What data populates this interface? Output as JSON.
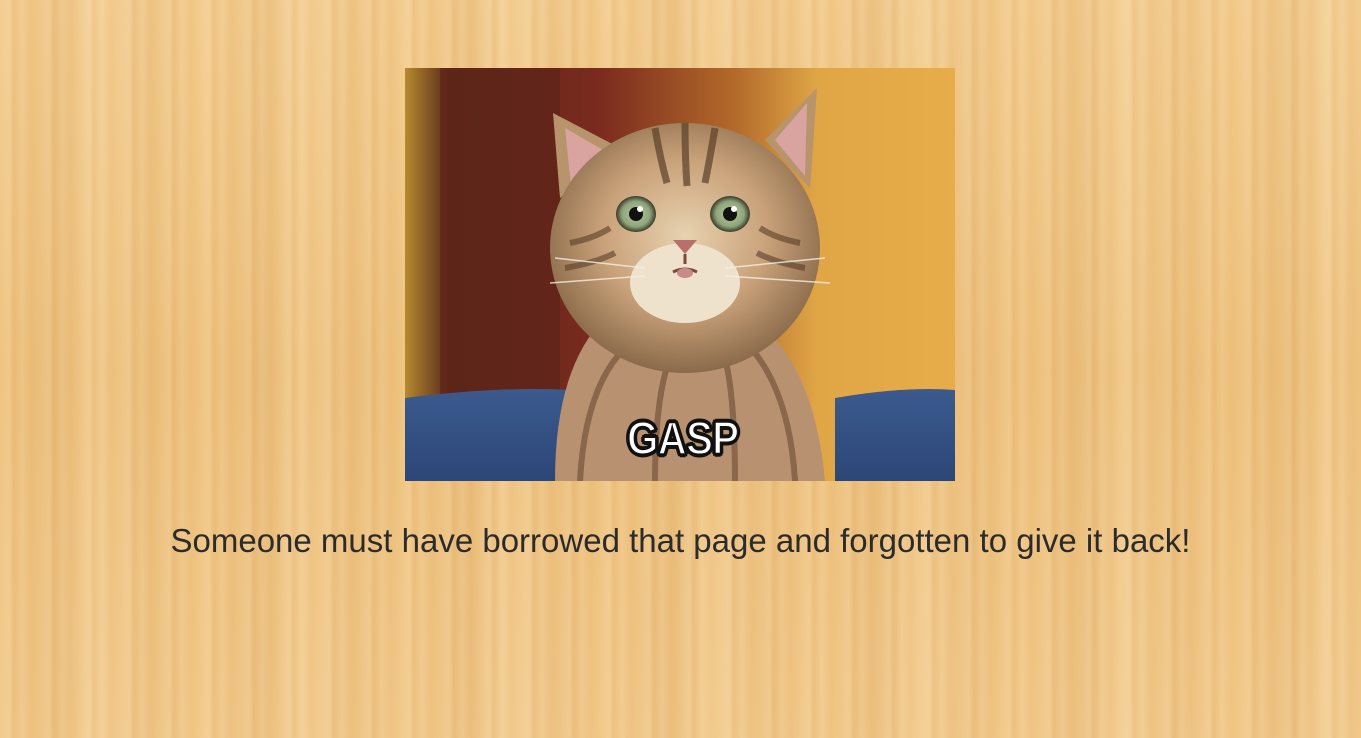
{
  "image": {
    "caption": "GASP",
    "subject": "kitten-photo"
  },
  "message": {
    "text": "Someone must have borrowed that page and forgotten to give it back!"
  },
  "colors": {
    "background": "#f2c98a",
    "message_text": "#2b2b2b"
  }
}
